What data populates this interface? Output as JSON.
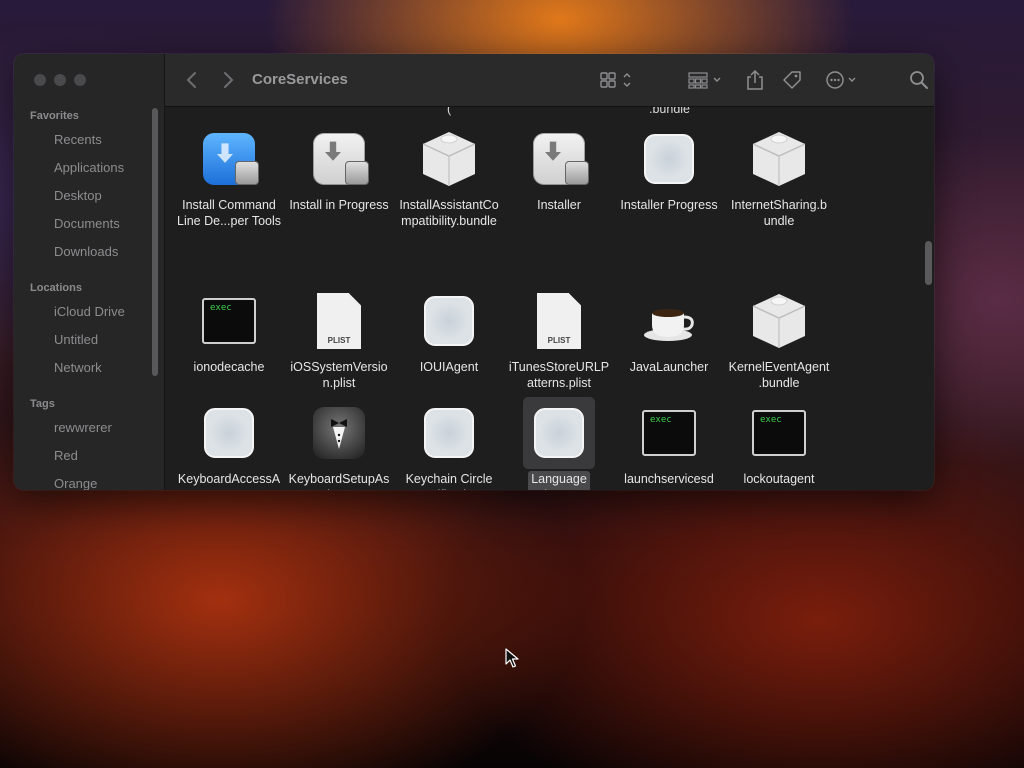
{
  "window": {
    "title": "CoreServices"
  },
  "sidebar": {
    "favorites_title": "Favorites",
    "favorites": [
      "Recents",
      "Applications",
      "Desktop",
      "Documents",
      "Downloads"
    ],
    "locations_title": "Locations",
    "locations": [
      "iCloud Drive",
      "Untitled",
      "Network"
    ],
    "tags_title": "Tags",
    "tags": [
      "rewwrerer",
      "Red",
      "Orange"
    ]
  },
  "toolbar": {
    "back_icon": "chevron-left-icon",
    "forward_icon": "chevron-right-icon",
    "view_icon": "grid-view-icon",
    "group_icon": "group-by-icon",
    "share_icon": "share-icon",
    "tag_icon": "tag-icon",
    "more_icon": "ellipsis-circle-icon",
    "search_icon": "search-icon"
  },
  "partial_top": {
    "left": "(",
    "right": ".bundle"
  },
  "rows": [
    [
      {
        "label": "Install Command\nLine De...per Tools",
        "icon": "blue-installer-icon"
      },
      {
        "label": "Install in Progress",
        "icon": "installer-icon"
      },
      {
        "label": "InstallAssistantCo\nmpatibility.bundle",
        "icon": "bundle-icon"
      },
      {
        "label": "Installer",
        "icon": "installer-icon"
      },
      {
        "label": "Installer Progress",
        "icon": "generic-app-icon"
      },
      {
        "label": "InternetSharing.b\nundle",
        "icon": "bundle-icon"
      }
    ],
    [
      {
        "label": "ionodecache",
        "icon": "exec-icon"
      },
      {
        "label": "iOSSystemVersio\nn.plist",
        "icon": "plist-icon"
      },
      {
        "label": "IOUIAgent",
        "icon": "generic-app-icon"
      },
      {
        "label": "iTunesStoreURLP\natterns.plist",
        "icon": "plist-icon"
      },
      {
        "label": "JavaLauncher",
        "icon": "coffee-cup-icon"
      },
      {
        "label": "KernelEventAgent\n.bundle",
        "icon": "bundle-icon"
      }
    ],
    [
      {
        "label": "KeyboardAccessA\ngent",
        "icon": "generic-app-icon"
      },
      {
        "label": "KeyboardSetupAs\nsistant",
        "icon": "tuxedo-icon"
      },
      {
        "label": "Keychain Circle\nNotification",
        "icon": "generic-app-icon"
      },
      {
        "label": "Language\nChooser",
        "icon": "generic-app-icon",
        "selected": true
      },
      {
        "label": "launchservicesd",
        "icon": "exec-icon"
      },
      {
        "label": "lockoutagent",
        "icon": "exec-icon"
      }
    ]
  ],
  "bottom_row_icons": [
    "exec-icon",
    "generic-app-icon",
    "bundle-icon",
    "generic-app-icon",
    "exec-icon",
    "folder-icon"
  ],
  "exec_text": "exec",
  "plist_text": "PLIST",
  "colors": {
    "window_bg": "#1e1e1e",
    "sidebar_bg": "#262627",
    "folder_blue": "#2fa4f0",
    "exec_green": "#3bd14b"
  }
}
